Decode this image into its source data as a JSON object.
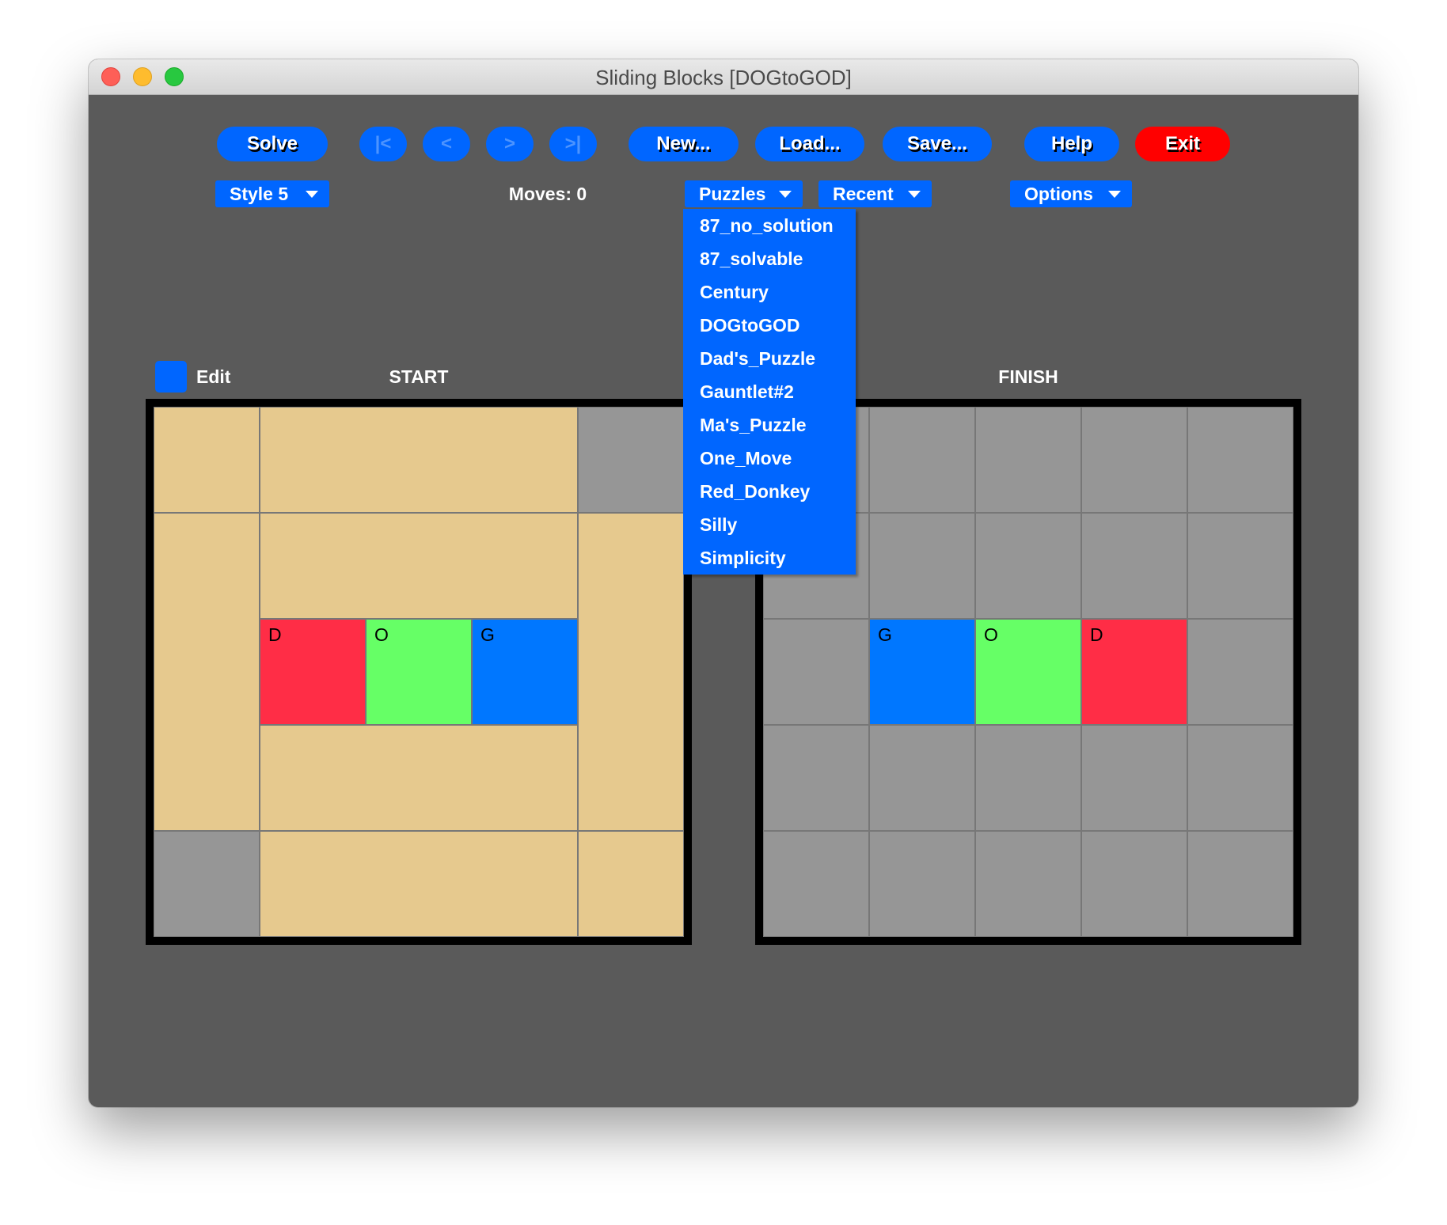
{
  "window": {
    "title": "Sliding Blocks [DOGtoGOD]"
  },
  "toolbar": {
    "solve": "Solve",
    "first": "|<",
    "prev": "<",
    "next": ">",
    "last": ">|",
    "new": "New...",
    "load": "Load...",
    "save": "Save...",
    "help": "Help",
    "exit": "Exit"
  },
  "controls": {
    "style": "Style 5",
    "moves": "Moves: 0",
    "puzzles": "Puzzles",
    "recent": "Recent",
    "options": "Options"
  },
  "puzzles_menu": {
    "items": [
      "87_no_solution",
      "87_solvable",
      "Century",
      "DOGtoGOD",
      "Dad's_Puzzle",
      "Gauntlet#2",
      "Ma's_Puzzle",
      "One_Move",
      "Red_Donkey",
      "Silly",
      "Simplicity"
    ]
  },
  "edit": {
    "label": "Edit",
    "checked": false
  },
  "colors": {
    "button": "#0066ff",
    "exit": "#ff0000",
    "tan": "#e6c98e",
    "empty": "#969696",
    "red": "#ff2d46",
    "green": "#66ff66",
    "blue": "#0077ff"
  },
  "boards": {
    "grid": {
      "cols": 5,
      "rows": 5
    },
    "start": {
      "label": "START",
      "pieces": [
        {
          "col": 0,
          "row": 0,
          "w": 1,
          "h": 1,
          "color": "tan",
          "label": ""
        },
        {
          "col": 1,
          "row": 0,
          "w": 3,
          "h": 1,
          "color": "tan",
          "label": ""
        },
        {
          "col": 4,
          "row": 0,
          "w": 1,
          "h": 1,
          "color": "empty",
          "label": ""
        },
        {
          "col": 0,
          "row": 1,
          "w": 1,
          "h": 3,
          "color": "tan",
          "label": ""
        },
        {
          "col": 1,
          "row": 1,
          "w": 3,
          "h": 1,
          "color": "tan",
          "label": ""
        },
        {
          "col": 4,
          "row": 1,
          "w": 1,
          "h": 3,
          "color": "tan",
          "label": ""
        },
        {
          "col": 1,
          "row": 2,
          "w": 1,
          "h": 1,
          "color": "red",
          "label": "D"
        },
        {
          "col": 2,
          "row": 2,
          "w": 1,
          "h": 1,
          "color": "green",
          "label": "O"
        },
        {
          "col": 3,
          "row": 2,
          "w": 1,
          "h": 1,
          "color": "blue",
          "label": "G"
        },
        {
          "col": 1,
          "row": 3,
          "w": 3,
          "h": 1,
          "color": "tan",
          "label": ""
        },
        {
          "col": 0,
          "row": 4,
          "w": 1,
          "h": 1,
          "color": "empty",
          "label": ""
        },
        {
          "col": 1,
          "row": 4,
          "w": 3,
          "h": 1,
          "color": "tan",
          "label": ""
        },
        {
          "col": 4,
          "row": 4,
          "w": 1,
          "h": 1,
          "color": "tan",
          "label": ""
        }
      ]
    },
    "finish": {
      "label": "FINISH",
      "pieces": [
        {
          "col": 1,
          "row": 2,
          "w": 1,
          "h": 1,
          "color": "blue",
          "label": "G"
        },
        {
          "col": 2,
          "row": 2,
          "w": 1,
          "h": 1,
          "color": "green",
          "label": "O"
        },
        {
          "col": 3,
          "row": 2,
          "w": 1,
          "h": 1,
          "color": "red",
          "label": "D"
        }
      ],
      "fill_empty": true
    }
  }
}
